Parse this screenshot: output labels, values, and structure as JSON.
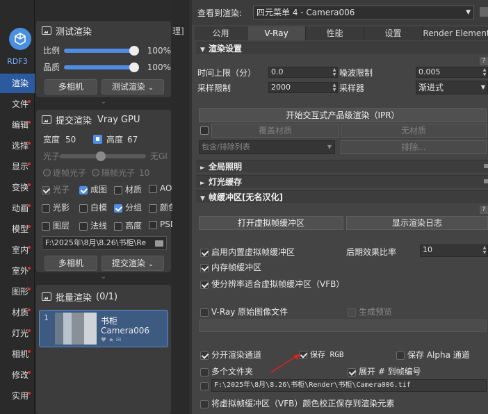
{
  "nav": {
    "badge": "RDF3",
    "items": [
      "渲染",
      "文件",
      "编辑",
      "选择",
      "显示",
      "变换",
      "动画",
      "模型",
      "室内",
      "室外",
      "图形",
      "材质",
      "灯光",
      "相机",
      "修改",
      "实用"
    ]
  },
  "test_render": {
    "title": "测试渲染",
    "ratio_label": "比例",
    "ratio_value": "100%",
    "ratio_level": 1.0,
    "quality_label": "品质",
    "quality_value": "100%",
    "quality_level": 1.0,
    "multi_camera": "多相机",
    "render_button": "测试渲染"
  },
  "submit_render": {
    "title": "提交渲染",
    "engine": "Vray GPU",
    "width_label": "宽度",
    "width_value": "50",
    "height_label": "高度",
    "height_value": "67",
    "photon_label": "光子",
    "no_gi": "无GI",
    "per_frame_photon": "逐帧光子",
    "interval_photon": "隔帧光子",
    "interval_value": "10",
    "options": [
      {
        "label": "光子",
        "checked": true,
        "style": "grey"
      },
      {
        "label": "成图",
        "checked": true,
        "style": "blue"
      },
      {
        "label": "材质",
        "checked": false,
        "style": "normal"
      },
      {
        "label": "AO",
        "checked": false,
        "style": "normal"
      },
      {
        "label": "光影",
        "checked": false,
        "style": "normal"
      },
      {
        "label": "白模",
        "checked": false,
        "style": "normal"
      },
      {
        "label": "分组",
        "checked": true,
        "style": "blue"
      },
      {
        "label": "颜色",
        "checked": false,
        "style": "normal"
      },
      {
        "label": "图层",
        "checked": false,
        "style": "normal"
      },
      {
        "label": "法线",
        "checked": false,
        "style": "normal"
      },
      {
        "label": "高度",
        "checked": false,
        "style": "normal"
      },
      {
        "label": "PSD",
        "checked": false,
        "style": "normal"
      }
    ],
    "path": "F:\\2025年\\8月\\8.26\\书柜\\Re",
    "multi_camera": "多相机",
    "submit_button": "提交渲染"
  },
  "batch_render": {
    "title": "批量渲染",
    "count": "(0/1)",
    "job_index": "1",
    "job_name": "书柜",
    "job_camera": "Camera006"
  },
  "partial_text": "理]",
  "right": {
    "view_label": "查看到渲染:",
    "view_value": "四元菜单 4 - Camera006",
    "tabs": [
      "公用",
      "V-Ray",
      "性能",
      "设置",
      "Render Element"
    ],
    "active_tab": 1,
    "sec_render_settings": "渲染设置",
    "time_limit_label": "时间上限（分）",
    "time_limit_value": "0.0",
    "noise_limit_label": "噪波限制",
    "noise_limit_value": "0.005",
    "sample_limit_label": "采样限制",
    "sample_limit_value": "2000",
    "sampler_label": "采样器",
    "sampler_value": "渐进式",
    "ipr_button": "开始交互式产品级渲染（IPR）",
    "override_mtl": "覆盖材质",
    "no_material": "无材质",
    "include_exclude": "包含/排除列表",
    "exclude": "排除...",
    "sec_gi": "全局照明",
    "sec_light_cache": "灯光缓存",
    "sec_framebuffer": "帧缓冲区[无名汉化]",
    "open_vfb": "打开虚拟帧缓冲区",
    "show_log": "显示渲染日志",
    "use_builtin_vfb": "启用内置虚拟帧缓冲区",
    "post_effect_label": "后期效果比率",
    "post_effect_value": "10",
    "memory_fb": "内存帧缓冲区",
    "fit_resolution": "使分辨率适合虚拟帧缓冲区（VFB）",
    "vray_raw": "V-Ray 原始图像文件",
    "gen_preview": "生成预览",
    "separate_channels": "分开渲染通道",
    "save_rgb": "保存 RGB",
    "save_alpha": "保存 Alpha 通道",
    "multi_folder": "多个文件夹",
    "expand_frame": "展开 # 到帧编号",
    "out_path": "F:\\2025年\\8月\\8.26\\书柜\\Render\\书柜\\Camera006.tif",
    "color_correct": "将虚拟帧缓冲区（VFB）颜色校正保存到渲染元素"
  },
  "colors": {
    "accent": "#4f8de6",
    "active_nav": "#2c5aa0",
    "arrow": "#e02020"
  }
}
